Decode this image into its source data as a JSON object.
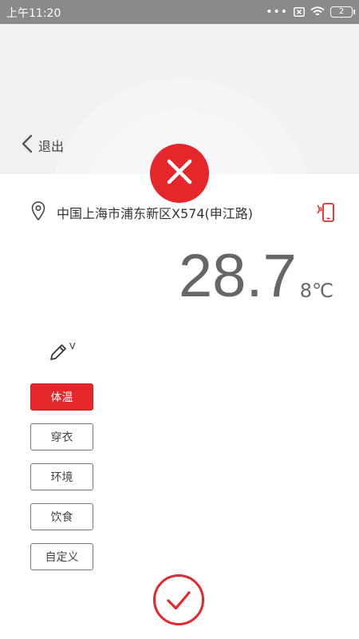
{
  "status_bar": {
    "time": "上午11:20",
    "battery": "2",
    "icons": [
      "more-dots-icon",
      "sim-x-icon",
      "wifi-icon",
      "battery-icon"
    ]
  },
  "header": {
    "back_label": "退出",
    "close_icon": "close-x-icon"
  },
  "location": {
    "address": "中国上海市浦东新区X574(申江路)",
    "pin_icon": "location-pin-icon",
    "device_icon": "phone-signal-icon"
  },
  "reading": {
    "value": "28.7",
    "unit": "8℃"
  },
  "edit": {
    "label": "V",
    "icon": "pencil-icon"
  },
  "categories": [
    {
      "label": "体温",
      "active": true
    },
    {
      "label": "穿衣",
      "active": false
    },
    {
      "label": "环境",
      "active": false
    },
    {
      "label": "饮食",
      "active": false
    },
    {
      "label": "自定义",
      "active": false
    }
  ],
  "confirm_icon": "checkmark-circle-icon",
  "colors": {
    "accent": "#e5262b",
    "status_bar": "#8a8a8a",
    "header_bg": "#f1f0f3",
    "text": "#333333"
  }
}
